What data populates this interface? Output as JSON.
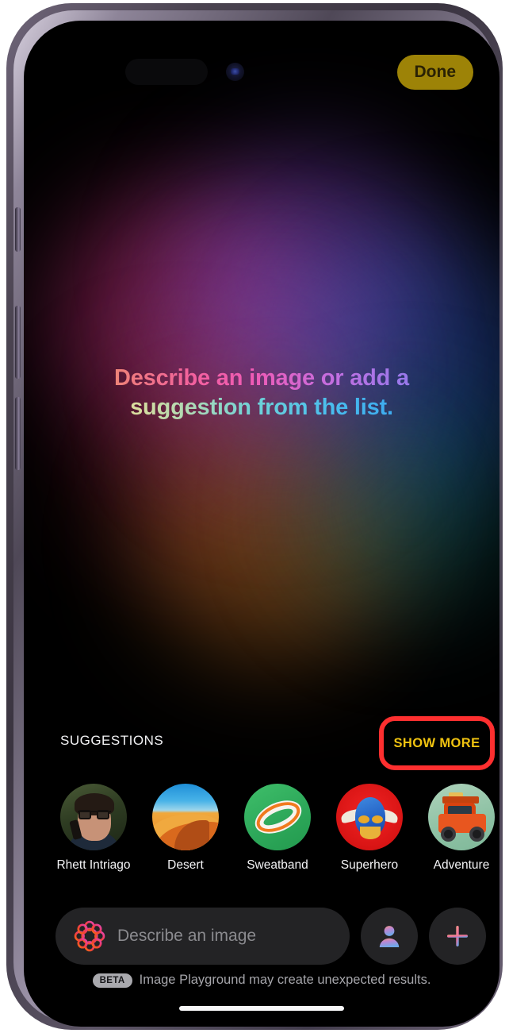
{
  "app": {
    "name": "Image Playground",
    "done_label": "Done"
  },
  "headline": {
    "line1": "Describe an image or add a",
    "line2": "suggestion from the list."
  },
  "suggestions": {
    "section_label": "SUGGESTIONS",
    "show_more_label": "SHOW MORE",
    "items": [
      {
        "label": "Rhett Intriago",
        "icon": "person-photo-thumbnail"
      },
      {
        "label": "Desert",
        "icon": "desert-dune-thumbnail"
      },
      {
        "label": "Sweatband",
        "icon": "sweatband-thumbnail"
      },
      {
        "label": "Superhero",
        "icon": "superhero-mask-thumbnail"
      },
      {
        "label": "Adventure",
        "icon": "off-road-truck-thumbnail"
      }
    ]
  },
  "input": {
    "placeholder": "Describe an image",
    "value": "",
    "leading_icon": "image-playground-icon",
    "person_button_icon": "person-icon",
    "add_button_icon": "plus-icon"
  },
  "footer": {
    "badge": "BETA",
    "text": "Image Playground may create unexpected results."
  },
  "colors": {
    "done_button_bg": "#9d8307",
    "show_more_text": "#f0c310",
    "annotation_border": "#fe2f2f",
    "screen_bg": "#000000",
    "field_bg": "#232325"
  }
}
